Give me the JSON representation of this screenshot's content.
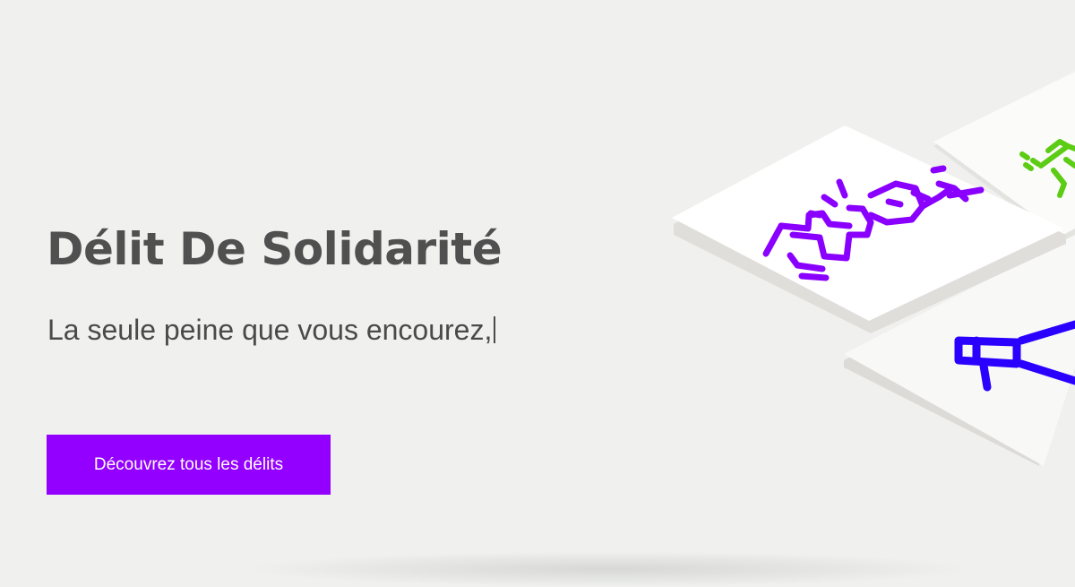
{
  "hero": {
    "title": "Délit De Solidarité",
    "subtitle": "La seule peine que vous encourez,",
    "cta_label": "Découvrez tous les délits"
  },
  "illustration": {
    "cards": [
      {
        "icon": "fist-bump-icon",
        "color": "#8a00ff"
      },
      {
        "icon": "running-figure-icon",
        "color": "#5ccc14"
      },
      {
        "icon": "megaphone-icon",
        "color": "#2a00ff"
      }
    ]
  },
  "colors": {
    "background": "#f0f1ee",
    "accent": "#9300ff",
    "title_text": "#505050",
    "subtitle_text": "#4a4a4a"
  }
}
